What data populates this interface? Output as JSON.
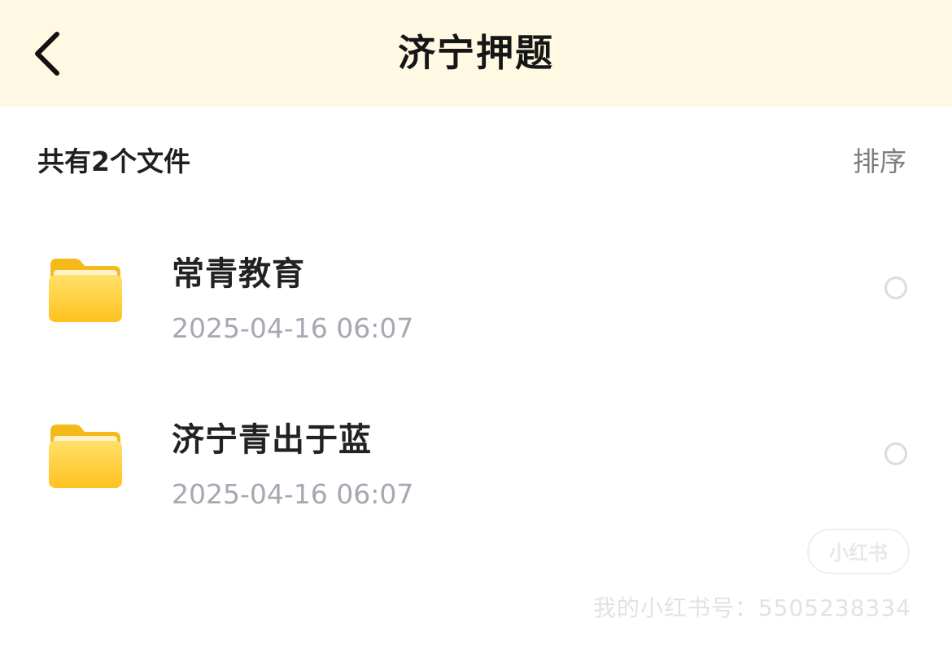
{
  "header": {
    "title": "济宁押题",
    "back_icon": "chevron-left-icon"
  },
  "toolbar": {
    "count_label": "共有2个文件",
    "sort_label": "排序"
  },
  "files": [
    {
      "name": "常青教育",
      "date": "2025-04-16 06:07",
      "icon": "folder-icon"
    },
    {
      "name": "济宁青出于蓝",
      "date": "2025-04-16 06:07",
      "icon": "folder-icon"
    }
  ],
  "watermark": {
    "logo": "小红书",
    "text": "我的小红书号：5505238334"
  },
  "colors": {
    "header_bg": "#fff8e3",
    "folder_yellow": "#ffcf2e",
    "date_gray": "#a6a8b2",
    "sort_gray": "#7d7d84"
  }
}
